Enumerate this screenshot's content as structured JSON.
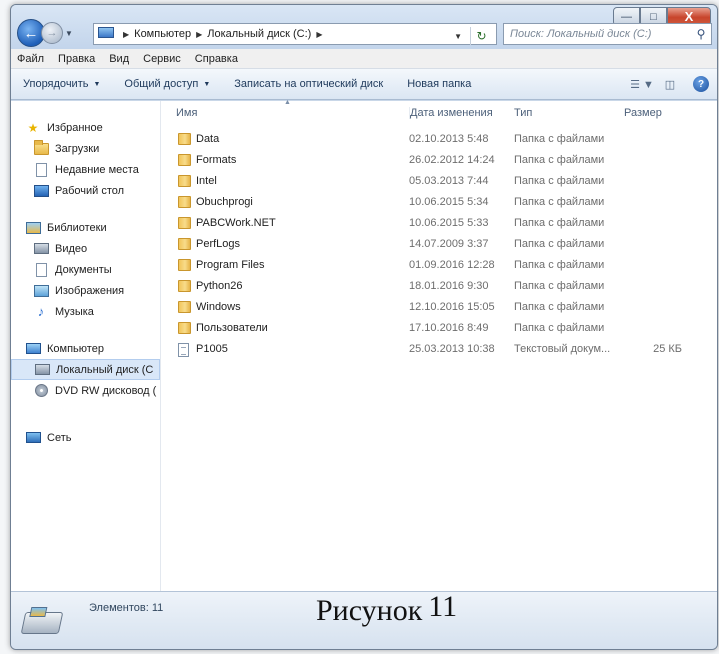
{
  "window": {
    "controls": {
      "minimize": "—",
      "maximize": "□",
      "close": "X"
    }
  },
  "address": {
    "crumbs": [
      "Компьютер",
      "Локальный диск (C:)"
    ],
    "search_placeholder": "Поиск: Локальный диск (C:)"
  },
  "menu": [
    "Файл",
    "Правка",
    "Вид",
    "Сервис",
    "Справка"
  ],
  "toolbar": {
    "organize": "Упорядочить",
    "share": "Общий доступ",
    "burn": "Записать на оптический диск",
    "new_folder": "Новая папка"
  },
  "sidebar": {
    "favorites": {
      "label": "Избранное",
      "items": [
        "Загрузки",
        "Недавние места",
        "Рабочий стол"
      ]
    },
    "libraries": {
      "label": "Библиотеки",
      "items": [
        "Видео",
        "Документы",
        "Изображения",
        "Музыка"
      ]
    },
    "computer": {
      "label": "Компьютер",
      "items": [
        "Локальный диск (C",
        "DVD RW дисковод ("
      ]
    },
    "network": {
      "label": "Сеть"
    }
  },
  "columns": {
    "name": "Имя",
    "date": "Дата изменения",
    "type": "Тип",
    "size": "Размер"
  },
  "files": [
    {
      "name": "Data",
      "date": "02.10.2013 5:48",
      "type": "Папка с файлами",
      "size": "",
      "kind": "folder"
    },
    {
      "name": "Formats",
      "date": "26.02.2012 14:24",
      "type": "Папка с файлами",
      "size": "",
      "kind": "folder"
    },
    {
      "name": "Intel",
      "date": "05.03.2013 7:44",
      "type": "Папка с файлами",
      "size": "",
      "kind": "folder"
    },
    {
      "name": "Obuchprogi",
      "date": "10.06.2015 5:34",
      "type": "Папка с файлами",
      "size": "",
      "kind": "folder"
    },
    {
      "name": "PABCWork.NET",
      "date": "10.06.2015 5:33",
      "type": "Папка с файлами",
      "size": "",
      "kind": "folder"
    },
    {
      "name": "PerfLogs",
      "date": "14.07.2009 3:37",
      "type": "Папка с файлами",
      "size": "",
      "kind": "folder"
    },
    {
      "name": "Program Files",
      "date": "01.09.2016 12:28",
      "type": "Папка с файлами",
      "size": "",
      "kind": "folder"
    },
    {
      "name": "Python26",
      "date": "18.01.2016 9:30",
      "type": "Папка с файлами",
      "size": "",
      "kind": "folder"
    },
    {
      "name": "Windows",
      "date": "12.10.2016 15:05",
      "type": "Папка с файлами",
      "size": "",
      "kind": "folder"
    },
    {
      "name": "Пользователи",
      "date": "17.10.2016 8:49",
      "type": "Папка с файлами",
      "size": "",
      "kind": "folder"
    },
    {
      "name": "P1005",
      "date": "25.03.2013 10:38",
      "type": "Текстовый докум...",
      "size": "25 КБ",
      "kind": "text"
    }
  ],
  "status": {
    "items_label": "Элементов: 11"
  },
  "caption": {
    "word": "Рисунок",
    "number": "11"
  }
}
